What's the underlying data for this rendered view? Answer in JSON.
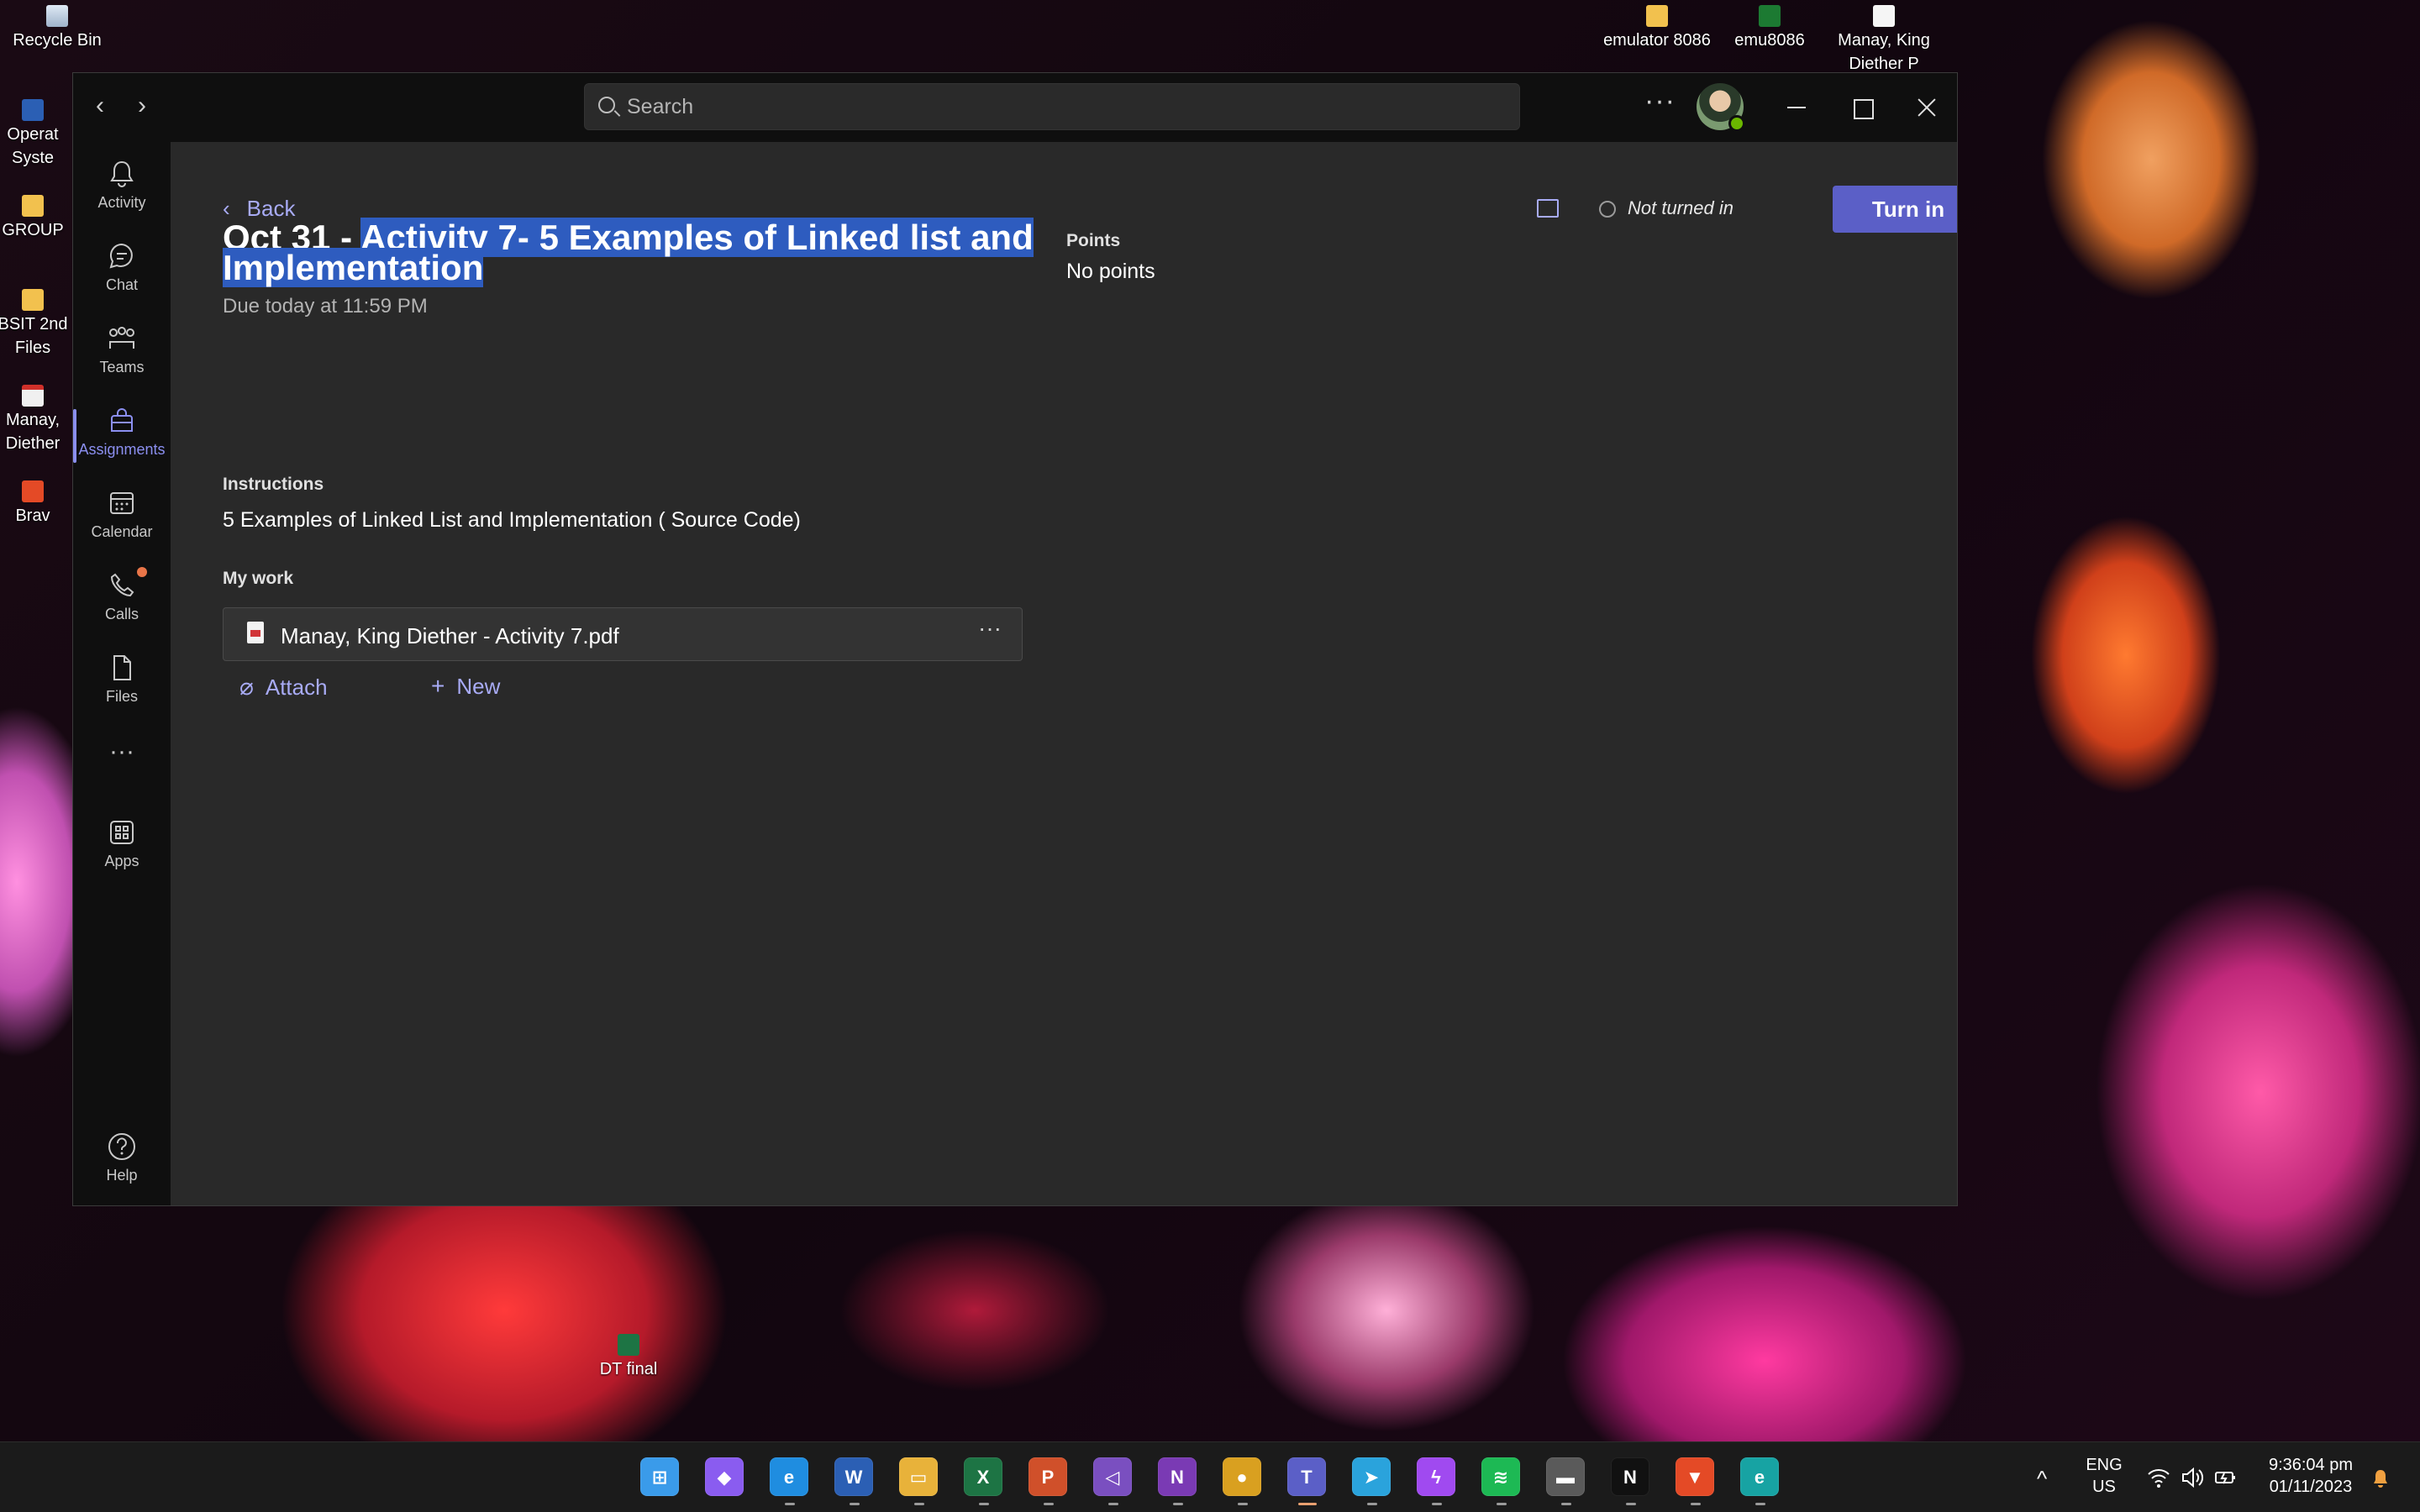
{
  "desktop": {
    "icons": [
      {
        "label": "Recycle Bin",
        "icon": "recycle-bin-icon"
      },
      {
        "label": "Operat Syste",
        "icon": "word-doc-icon"
      },
      {
        "label": "GROUP",
        "icon": "folder-icon"
      },
      {
        "label": "BSIT 2nd Files",
        "icon": "folder-icon"
      },
      {
        "label": "Manay, Diether",
        "icon": "pdf-icon"
      },
      {
        "label": "Brav",
        "icon": "brave-icon"
      },
      {
        "label": "emulator 8086",
        "icon": "folder-icon"
      },
      {
        "label": "emu8086",
        "icon": "emu8086-icon"
      },
      {
        "label": "Manay, King Diether P",
        "icon": "document-icon"
      },
      {
        "label": "DT final",
        "icon": "excel-icon"
      }
    ]
  },
  "window": {
    "search": {
      "placeholder": "Search"
    },
    "nav": {
      "back": "‹",
      "forward": "›"
    },
    "more": "···",
    "avatar_status_color": "#6bb700"
  },
  "rail": {
    "items": [
      {
        "label": "Activity",
        "icon": "bell-icon"
      },
      {
        "label": "Chat",
        "icon": "chat-icon"
      },
      {
        "label": "Teams",
        "icon": "teams-icon"
      },
      {
        "label": "Assignments",
        "icon": "assignments-icon",
        "active": true
      },
      {
        "label": "Calendar",
        "icon": "calendar-icon"
      },
      {
        "label": "Calls",
        "icon": "phone-icon",
        "badge": true
      },
      {
        "label": "Files",
        "icon": "file-icon"
      },
      {
        "label": "",
        "icon": "more-icon"
      },
      {
        "label": "Apps",
        "icon": "apps-icon"
      },
      {
        "label": "Help",
        "icon": "help-icon"
      }
    ],
    "more_glyph": "···",
    "accent_color": "#8b8ff0"
  },
  "assignment": {
    "back_label": "Back",
    "status": "Not turned in",
    "turn_in_label": "Turn in",
    "title_prefix": "Oct 31 - ",
    "title_selected": "Activity 7- 5 Examples of Linked list and Implementation",
    "due": "Due today at 11:59 PM",
    "points_label": "Points",
    "points_value": "No points",
    "instructions_label": "Instructions",
    "instructions_text": "5 Examples of Linked List and Implementation ( Source Code)",
    "my_work_label": "My work",
    "file_name": "Manay, King Diether - Activity 7.pdf",
    "file_more": "···",
    "attach_label": "Attach",
    "new_label": "New",
    "accent_color": "#5b5fc7",
    "link_color": "#a8abf5"
  },
  "taskbar": {
    "apps": [
      {
        "name": "start-icon",
        "glyph": "⊞",
        "color": "#3a9bea"
      },
      {
        "name": "copilot-pre-icon",
        "glyph": "◆",
        "color": "#8a5cf0"
      },
      {
        "name": "edge-icon",
        "glyph": "e",
        "color": "#1f8de0"
      },
      {
        "name": "word-icon",
        "glyph": "W",
        "color": "#2b5fb4"
      },
      {
        "name": "file-explorer-icon",
        "glyph": "▭",
        "color": "#e8b23a"
      },
      {
        "name": "excel-icon",
        "glyph": "X",
        "color": "#1d7444"
      },
      {
        "name": "powerpoint-icon",
        "glyph": "P",
        "color": "#d0502a"
      },
      {
        "name": "visual-studio-icon",
        "glyph": "◁",
        "color": "#7a4fc0"
      },
      {
        "name": "onenote-icon",
        "glyph": "N",
        "color": "#7a3ab4"
      },
      {
        "name": "chrome-icon",
        "glyph": "●",
        "color": "#d9a020"
      },
      {
        "name": "teams-icon",
        "glyph": "T",
        "color": "#5b5fc7",
        "active": true
      },
      {
        "name": "telegram-icon",
        "glyph": "➤",
        "color": "#2aa3dc"
      },
      {
        "name": "messenger-icon",
        "glyph": "ϟ",
        "color": "#a04af0"
      },
      {
        "name": "spotify-icon",
        "glyph": "≋",
        "color": "#1db954"
      },
      {
        "name": "racing-game-icon",
        "glyph": "▬",
        "color": "#5a5a5a"
      },
      {
        "name": "netflix-icon",
        "glyph": "N",
        "color": "#111111"
      },
      {
        "name": "brave-icon",
        "glyph": "▼",
        "color": "#e44a26"
      },
      {
        "name": "eset-icon",
        "glyph": "e",
        "color": "#17a3a3"
      }
    ],
    "tray": {
      "chevron": "^",
      "lang_line1": "ENG",
      "lang_line2": "US",
      "time": "9:36:04 pm",
      "date": "01/11/2023"
    }
  }
}
